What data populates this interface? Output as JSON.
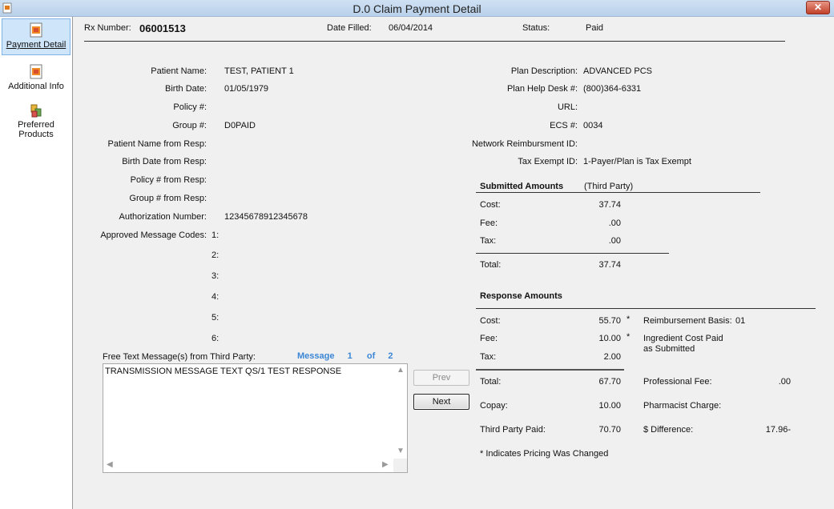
{
  "window": {
    "title": "D.0 Claim Payment Detail",
    "close_label": "✕"
  },
  "sidebar": {
    "items": [
      {
        "label": "Payment Detail",
        "accesskey": "P"
      },
      {
        "label": "Additional Info",
        "accesskey": "A"
      },
      {
        "label_line1": "Preferred",
        "label_line2": "Products"
      }
    ]
  },
  "header": {
    "rx_label": "Rx Number:",
    "rx_value": "06001513",
    "date_label": "Date Filled:",
    "date_value": "06/04/2014",
    "status_label": "Status:",
    "status_value": "Paid"
  },
  "patient": {
    "name_label": "Patient Name:",
    "name_value": "TEST, PATIENT 1",
    "birth_label": "Birth Date:",
    "birth_value": "01/05/1979",
    "policy_label": "Policy #:",
    "policy_value": "",
    "group_label": "Group #:",
    "group_value": "D0PAID",
    "name_resp_label": "Patient Name from Resp:",
    "birth_resp_label": "Birth Date from Resp:",
    "policy_resp_label": "Policy # from Resp:",
    "group_resp_label": "Group # from Resp:",
    "auth_label": "Authorization Number:",
    "auth_value": "12345678912345678",
    "codes_label": "Approved Message Codes:",
    "codes": [
      "1:",
      "2:",
      "3:",
      "4:",
      "5:",
      "6:"
    ]
  },
  "messages": {
    "label": "Free Text Message(s) from Third Party:",
    "pager_word": "Message",
    "current": "1",
    "of_word": "of",
    "total": "2",
    "text": "TRANSMISSION MESSAGE TEXT QS/1 TEST RESPONSE",
    "prev_label": "Prev",
    "next_label": "Next"
  },
  "plan": {
    "desc_label": "Plan Description:",
    "desc_value": "ADVANCED PCS",
    "help_label": "Plan Help Desk #:",
    "help_value": "(800)364-6331",
    "url_label": "URL:",
    "url_value": "",
    "ecs_label": "ECS #:",
    "ecs_value": "0034",
    "network_label": "Network Reimbursment ID:",
    "network_value": "",
    "tax_label": "Tax Exempt ID:",
    "tax_value": "1-Payer/Plan is Tax Exempt"
  },
  "submitted": {
    "heading": "Submitted Amounts",
    "sub_heading": "(Third Party)",
    "cost_label": "Cost:",
    "cost_value": "37.74",
    "fee_label": "Fee:",
    "fee_value": ".00",
    "tax_label": "Tax:",
    "tax_value": ".00",
    "total_label": "Total:",
    "total_value": "37.74"
  },
  "response": {
    "heading": "Response Amounts",
    "cost_label": "Cost:",
    "cost_value": "55.70",
    "cost_flag": "*",
    "fee_label": "Fee:",
    "fee_value": "10.00",
    "fee_flag": "*",
    "tax_label": "Tax:",
    "tax_value": "2.00",
    "total_label": "Total:",
    "total_value": "67.70",
    "copay_label": "Copay:",
    "copay_value": "10.00",
    "tpp_label": "Third Party Paid:",
    "tpp_value": "70.70",
    "reimb_label": "Reimbursement Basis:",
    "reimb_value": "01",
    "ingredient_line1": "Ingredient Cost Paid",
    "ingredient_line2": "as Submitted",
    "prof_fee_label": "Professional Fee:",
    "prof_fee_value": ".00",
    "pharm_label": "Pharmacist Charge:",
    "pharm_value": "",
    "diff_label": "$ Difference:",
    "diff_value": "17.96-",
    "footnote": "* Indicates Pricing Was Changed"
  }
}
